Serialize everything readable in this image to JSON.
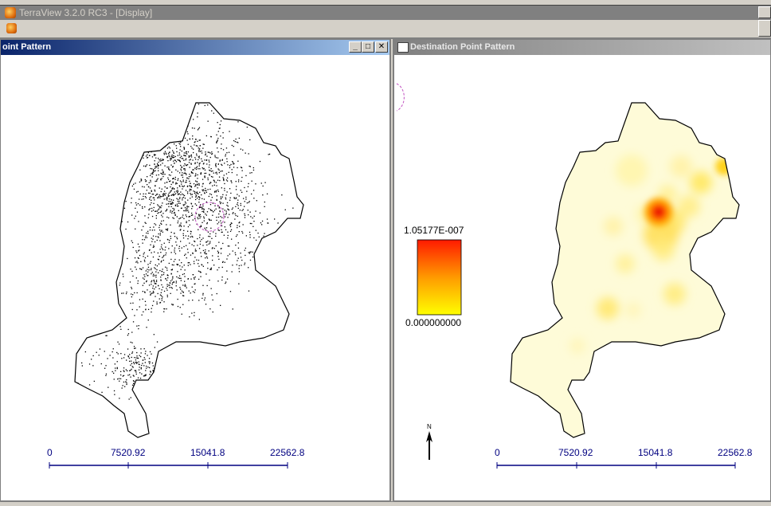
{
  "app": {
    "title": "TerraView 3.2.0 RC3 - [Display]"
  },
  "left_view": {
    "title": "oint Pattern",
    "buttons": {
      "minimize": "_",
      "maximize": "□",
      "close": "✕"
    },
    "scale": {
      "ticks": [
        "0",
        "7520.92",
        "15041.8",
        "22562.8"
      ]
    }
  },
  "right_view": {
    "title": "Destination Point Pattern",
    "legend": {
      "max": "1.05177E-007",
      "min": "0.000000000"
    },
    "north_label": "N",
    "scale": {
      "ticks": [
        "0",
        "7520.92",
        "15041.8",
        "22562.8"
      ]
    }
  },
  "colors": {
    "scale_bar": "#000080",
    "heat_low": "#ffff00",
    "heat_high": "#ff0000",
    "heat_background": "#fefbd8",
    "selection_circle": "#c050c0"
  },
  "icons": {
    "app": "terraview-globe-icon",
    "doc": "terraview-doc-icon",
    "north": "north-arrow-icon"
  }
}
